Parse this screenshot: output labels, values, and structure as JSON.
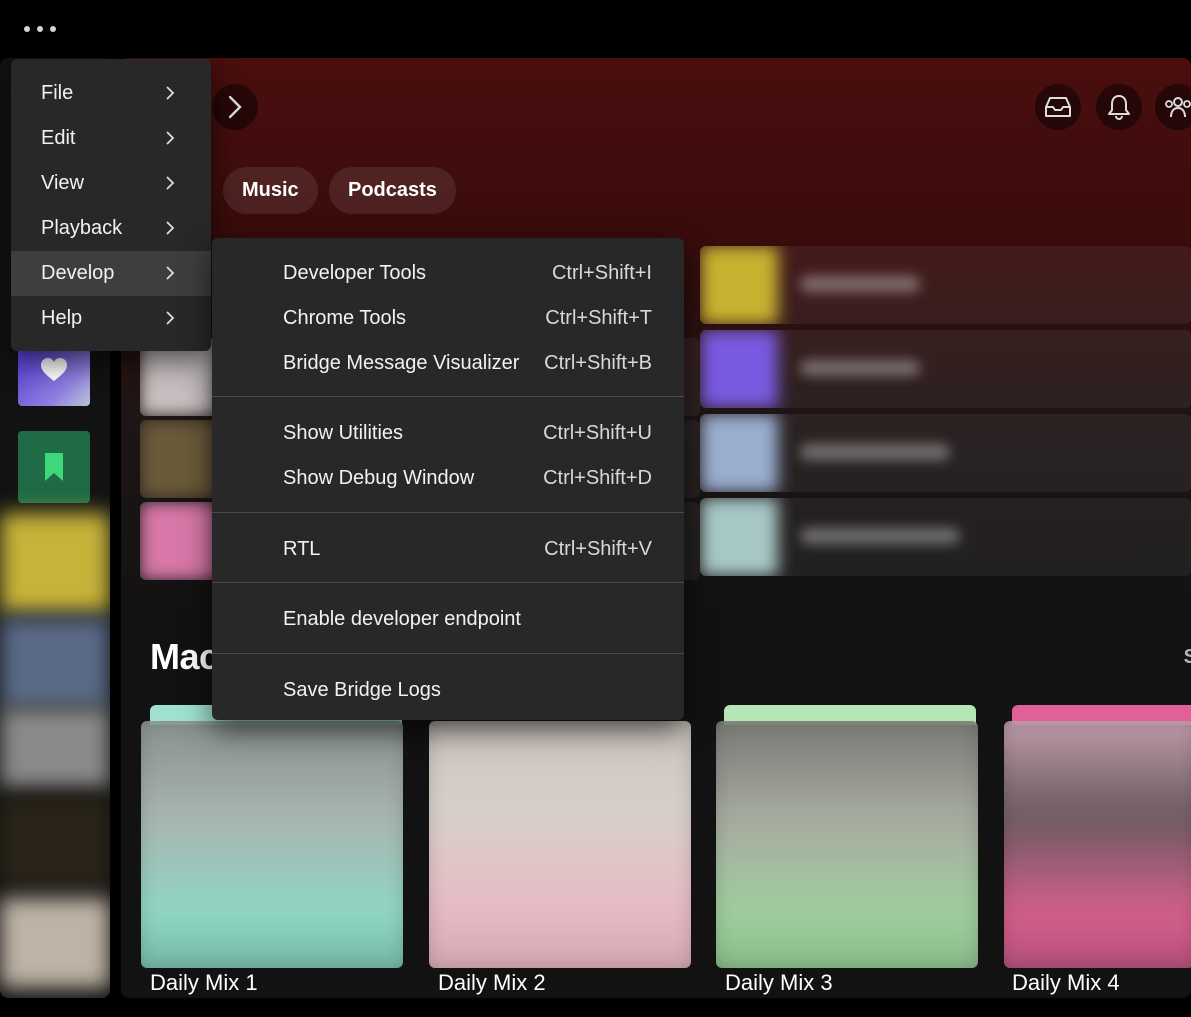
{
  "app": {
    "menu_button_label": "More options"
  },
  "header": {
    "chips": [
      "Music",
      "Podcasts"
    ],
    "icons": [
      "inbox-icon",
      "bell-icon",
      "friends-icon"
    ]
  },
  "main_menu": {
    "items": [
      {
        "label": "File"
      },
      {
        "label": "Edit"
      },
      {
        "label": "View"
      },
      {
        "label": "Playback"
      },
      {
        "label": "Develop"
      },
      {
        "label": "Help"
      }
    ],
    "active": "Develop"
  },
  "develop_menu": {
    "items": [
      {
        "label": "Developer Tools",
        "shortcut": "Ctrl+Shift+I"
      },
      {
        "label": "Chrome Tools",
        "shortcut": "Ctrl+Shift+T"
      },
      {
        "label": "Bridge Message Visualizer",
        "shortcut": "Ctrl+Shift+B"
      },
      {
        "label": "Show Utilities",
        "shortcut": "Ctrl+Shift+U"
      },
      {
        "label": "Show Debug Window",
        "shortcut": "Ctrl+Shift+D"
      },
      {
        "label": "RTL",
        "shortcut": "Ctrl+Shift+V"
      },
      {
        "label": "Enable developer endpoint",
        "shortcut": ""
      },
      {
        "label": "Save Bridge Logs",
        "shortcut": ""
      }
    ]
  },
  "section": {
    "title": "Mac",
    "show_all": "S",
    "cards": [
      {
        "title": "Daily Mix 1",
        "accent": "#9fe0cf"
      },
      {
        "title": "Daily Mix 2",
        "accent": "#f0c4cf"
      },
      {
        "title": "Daily Mix 3",
        "accent": "#a8dca8"
      },
      {
        "title": "Daily Mix 4",
        "accent": "#e0609a"
      }
    ]
  },
  "colors": {
    "menu_bg": "#282828",
    "menu_active": "#3e3e3e",
    "header_red": "#4a0e0e",
    "liked_gradient": "#4a2bd1",
    "saved_green": "#1e6b45"
  }
}
